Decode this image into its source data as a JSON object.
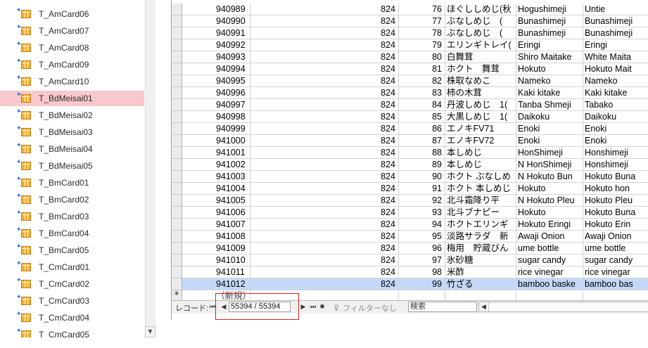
{
  "nav": {
    "items": [
      {
        "label": "T_AmCard06",
        "selected": false
      },
      {
        "label": "T_AmCard07",
        "selected": false
      },
      {
        "label": "T_AmCard08",
        "selected": false
      },
      {
        "label": "T_AmCard09",
        "selected": false
      },
      {
        "label": "T_AmCard10",
        "selected": false
      },
      {
        "label": "T_BdMeisai01",
        "selected": true
      },
      {
        "label": "T_BdMeisai02",
        "selected": false
      },
      {
        "label": "T_BdMeisai03",
        "selected": false
      },
      {
        "label": "T_BdMeisai04",
        "selected": false
      },
      {
        "label": "T_BdMeisai05",
        "selected": false
      },
      {
        "label": "T_BmCard01",
        "selected": false
      },
      {
        "label": "T_BmCard02",
        "selected": false
      },
      {
        "label": "T_BmCard03",
        "selected": false
      },
      {
        "label": "T_BmCard04",
        "selected": false
      },
      {
        "label": "T_BmCard05",
        "selected": false
      },
      {
        "label": "T_CmCard01",
        "selected": false
      },
      {
        "label": "T_CmCard02",
        "selected": false
      },
      {
        "label": "T_CmCard03",
        "selected": false
      },
      {
        "label": "T_CmCard04",
        "selected": false
      },
      {
        "label": "T_CmCard05",
        "selected": false
      }
    ],
    "item_icon": "table-icon",
    "selected_color": "#f8c8cc"
  },
  "datasheet": {
    "rows": [
      {
        "id": "940989",
        "a": "824",
        "b": "76",
        "c": "ほぐししめじ(秋",
        "d": "Hogushimeji",
        "e": "Untie"
      },
      {
        "id": "940990",
        "a": "824",
        "b": "77",
        "c": "ぶなしめじ　(",
        "d": "Bunashimeji",
        "e": "Bunashimeji"
      },
      {
        "id": "940991",
        "a": "824",
        "b": "78",
        "c": "ぶなしめじ　(",
        "d": "Bunashimeji",
        "e": "Bunashimeji"
      },
      {
        "id": "940992",
        "a": "824",
        "b": "79",
        "c": "エリンギトレイ(",
        "d": "Eringi",
        "e": "Eringi"
      },
      {
        "id": "940993",
        "a": "824",
        "b": "80",
        "c": "白舞茸",
        "d": "Shiro Maitake",
        "e": "White Maita"
      },
      {
        "id": "940994",
        "a": "824",
        "b": "81",
        "c": "ホクト　舞茸",
        "d": "Hokuto",
        "e": "Hokuto Mait"
      },
      {
        "id": "940995",
        "a": "824",
        "b": "82",
        "c": "株取なめこ",
        "d": "Nameko",
        "e": "Nameko"
      },
      {
        "id": "940996",
        "a": "824",
        "b": "83",
        "c": "柿の木茸",
        "d": "Kaki kitake",
        "e": "Kaki kitake"
      },
      {
        "id": "940997",
        "a": "824",
        "b": "84",
        "c": "丹波しめじ　1(",
        "d": "Tanba Shmeji",
        "e": "Tabako"
      },
      {
        "id": "940998",
        "a": "824",
        "b": "85",
        "c": "大黒しめじ　1(",
        "d": "Daikoku",
        "e": "Daikoku"
      },
      {
        "id": "940999",
        "a": "824",
        "b": "86",
        "c": "エノキFV71",
        "d": "Enoki",
        "e": "Enoki"
      },
      {
        "id": "941000",
        "a": "824",
        "b": "87",
        "c": "エノキFV72",
        "d": "Enoki",
        "e": "Enoki"
      },
      {
        "id": "941001",
        "a": "824",
        "b": "88",
        "c": "本しめじ",
        "d": "HonShimeji",
        "e": "Honshimeji"
      },
      {
        "id": "941002",
        "a": "824",
        "b": "89",
        "c": "本しめじ",
        "d": "N HonShimeji",
        "e": "Honshimeji"
      },
      {
        "id": "941003",
        "a": "824",
        "b": "90",
        "c": "ホクト ぶなしめ",
        "d": "N Hokuto Bun",
        "e": "Hokuto Buna"
      },
      {
        "id": "941004",
        "a": "824",
        "b": "91",
        "c": "ホクト 本しめじ",
        "d": "Hokuto",
        "e": "Hokuto hon"
      },
      {
        "id": "941005",
        "a": "824",
        "b": "92",
        "c": "北斗霜降り平",
        "d": "N Hokuto Pleu",
        "e": "Hokuto Pleu"
      },
      {
        "id": "941006",
        "a": "824",
        "b": "93",
        "c": "北斗ブナピー",
        "d": "Hokuto",
        "e": "Hokuto Buna"
      },
      {
        "id": "941007",
        "a": "824",
        "b": "94",
        "c": "ホクトエリンギ",
        "d": "Hokuto Eringi",
        "e": "Hokuto Erin"
      },
      {
        "id": "941008",
        "a": "824",
        "b": "95",
        "c": "淡路サラダ　新",
        "d": "Awaji Onion",
        "e": "Awaji Onion"
      },
      {
        "id": "941009",
        "a": "824",
        "b": "96",
        "c": "梅用　貯蔵びん",
        "d": "ume  bottle",
        "e": "ume  bottle"
      },
      {
        "id": "941010",
        "a": "824",
        "b": "97",
        "c": "氷砂糖",
        "d": "sugar candy",
        "e": "sugar candy"
      },
      {
        "id": "941011",
        "a": "824",
        "b": "98",
        "c": "米酢",
        "d": "rice vinegar",
        "e": "rice vinegar"
      },
      {
        "id": "941012",
        "a": "824",
        "b": "99",
        "c": "竹ざる",
        "d": "bamboo baske",
        "e": "bamboo bas"
      }
    ],
    "selected_id": "941012",
    "new_row_marker": "*",
    "new_row_label": "（新規）",
    "selected_color": "#c3d9f7"
  },
  "record_bar": {
    "label": "レコード:",
    "first_icon": "first-record-icon",
    "prev_icon": "prev-record-icon",
    "next_icon": "next-record-icon",
    "last_icon": "last-record-icon",
    "new_icon": "new-record-icon",
    "current": "55394 / 55394",
    "filter_label": "フィルターなし",
    "search_placeholder": "検索"
  },
  "highlight_color": "#e02020"
}
